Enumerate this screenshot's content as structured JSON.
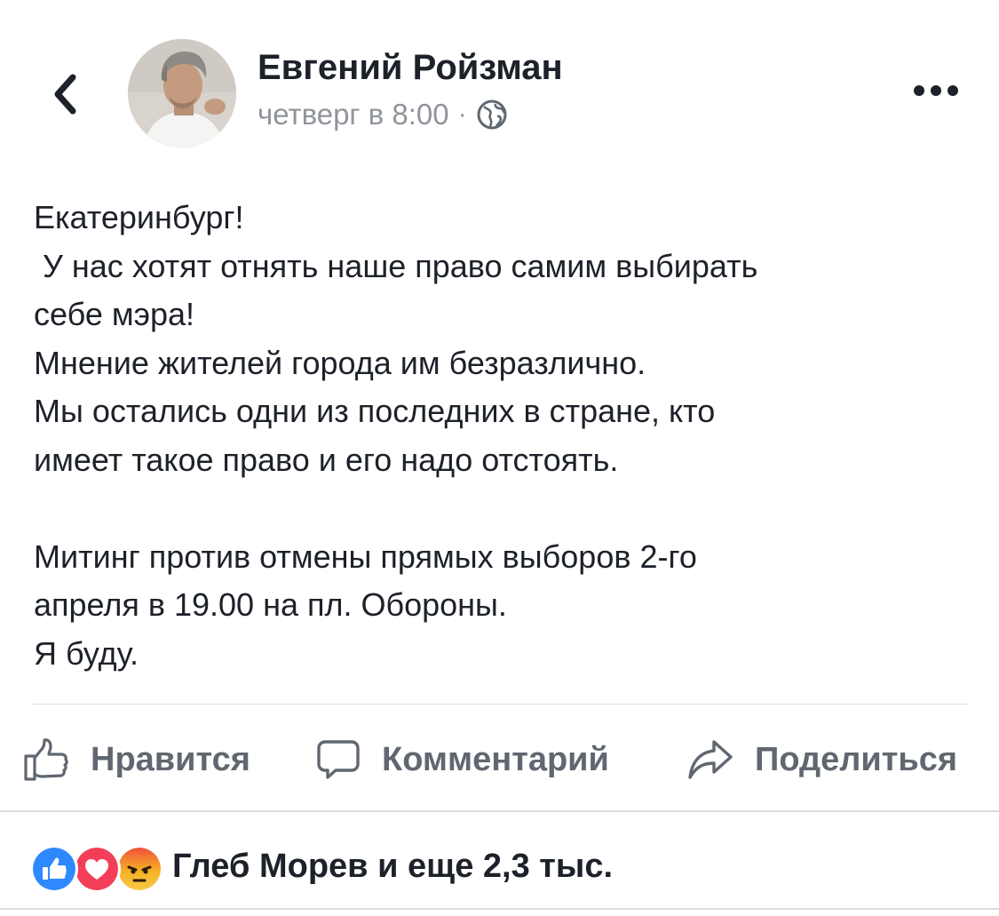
{
  "header": {
    "author_name": "Евгений Ройзман",
    "timestamp": "четверг в 8:00",
    "separator": "·",
    "privacy_icon": "globe-icon",
    "back_icon": "chevron-left-icon",
    "more_icon": "more-horizontal-icon"
  },
  "post": {
    "lines": [
      "Екатеринбург!",
      " У нас хотят отнять наше право самим выбирать",
      "себе мэра!",
      "Мнение жителей города им безразлично.",
      "Мы остались одни из последних в стране, кто",
      "имеет такое право и его надо отстоять.",
      "",
      "Митинг против отмены прямых выборов 2-го",
      "апреля в 19.00 на пл. Обороны.",
      "Я буду."
    ]
  },
  "actions": {
    "like_label": "Нравится",
    "comment_label": "Комментарий",
    "share_label": "Поделиться",
    "icon_color": "#606770"
  },
  "reactions": {
    "types": [
      "like",
      "love",
      "angry"
    ],
    "summary": "Глеб Морев и еще 2,3 тыс.",
    "colors": {
      "like": "#2e89ff",
      "love": "#f33e58",
      "angry": "#f7b125"
    }
  }
}
